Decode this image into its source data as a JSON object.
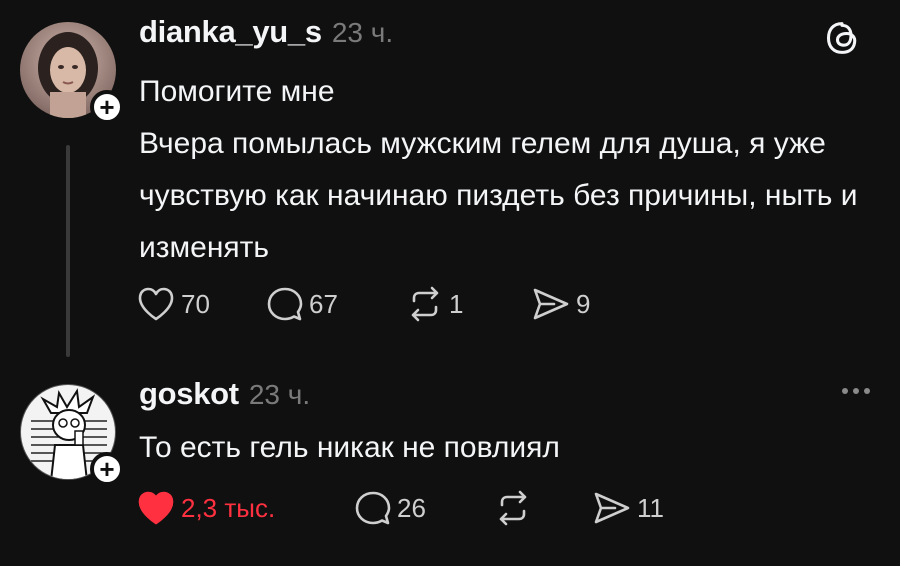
{
  "posts": [
    {
      "username": "dianka_yu_s",
      "time": "23 ч.",
      "paragraphs": [
        "Помогите мне",
        "Вчера помылась мужским гелем для душа, я уже чувствую как начинаю пиздеть без причины, ныть и изменять"
      ],
      "likes": "70",
      "comments": "67",
      "reposts": "1",
      "shares": "9",
      "liked": false
    },
    {
      "username": "goskot",
      "time": "23 ч.",
      "paragraphs": [
        "То есть гель никак не повлиял"
      ],
      "likes": "2,3 тыс.",
      "comments": "26",
      "reposts": "",
      "shares": "11",
      "liked": true
    }
  ],
  "icons": {
    "like": "heart-icon",
    "comment": "comment-icon",
    "repost": "repost-icon",
    "share": "send-icon",
    "brand": "threads-logo-icon",
    "more": "more-icon",
    "follow": "plus-icon"
  },
  "colors": {
    "background": "#101010",
    "text": "#f3f5f7",
    "muted": "#7a7a7a",
    "like_active": "#ff3040"
  }
}
